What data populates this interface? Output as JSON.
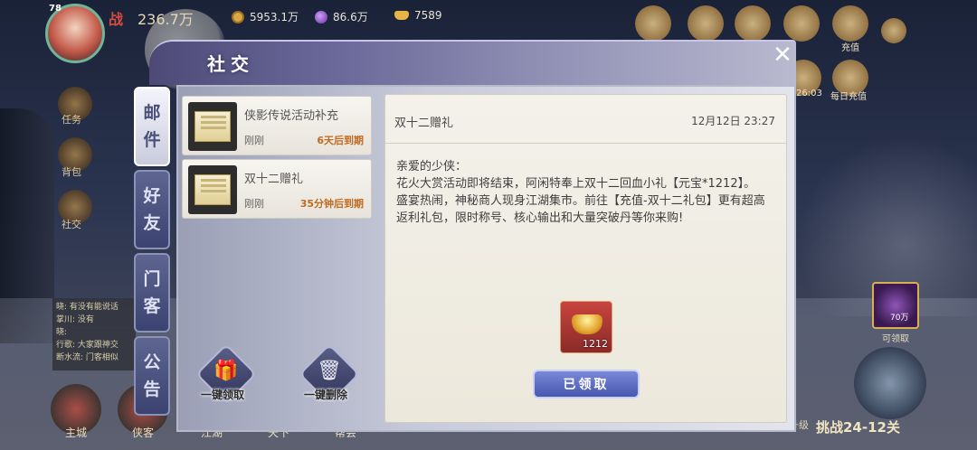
{
  "hud": {
    "level": "78",
    "power_icon": "战",
    "power": "236.7万",
    "coins": "5953.1万",
    "gems": "86.6万",
    "ingots": "7589",
    "top_labels": [
      "充值",
      "每日充值",
      "26:03"
    ]
  },
  "game_sidebar": {
    "items": [
      "任务",
      "背包",
      "社交"
    ],
    "chat_lines": [
      "晓: 有没有能说话",
      "掌川: 没有",
      "晓:",
      "行歌: 大家跟神交",
      "断水流: 门客相似"
    ]
  },
  "bottom_bar": [
    "主城",
    "侠客",
    "江湖",
    "天下",
    "帮会"
  ],
  "right_side": {
    "item_value": "70万",
    "claimable": "可领取",
    "progress": "挑战24-12关",
    "upgrade": "升级"
  },
  "modal": {
    "title": "社交",
    "close_glyph": "✕",
    "tabs": [
      {
        "label": "邮件",
        "active": true
      },
      {
        "label": "好友",
        "active": false
      },
      {
        "label": "门客",
        "active": false
      },
      {
        "label": "公告",
        "active": false
      }
    ],
    "mails": [
      {
        "title": "侠影传说活动补充",
        "time": "刚刚",
        "expire": "6天后到期"
      },
      {
        "title": "双十二赠礼",
        "time": "刚刚",
        "expire": "35分钟后到期"
      }
    ],
    "actions": {
      "claim_all": "一键领取",
      "delete_all": "一键删除"
    },
    "detail": {
      "title": "双十二赠礼",
      "date": "12月12日  23:27",
      "body_lines": [
        "亲爱的少侠：",
        "花火大赏活动即将结束，阿闲特奉上双十二回血小礼【元宝*1212】。",
        "盛宴热闹，神秘商人现身江湖集市。前往【充值-双十二礼包】更有超高返利礼包，限时称号、核心输出和大量突破丹等你来购!"
      ],
      "reward_qty": "1212",
      "claim_status": "已领取"
    }
  }
}
